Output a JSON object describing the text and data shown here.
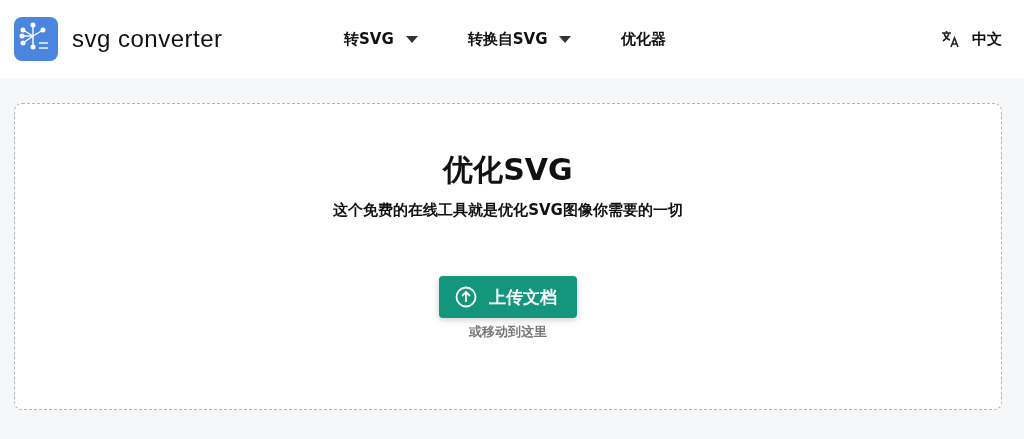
{
  "header": {
    "logo_text": "svg converter",
    "nav": [
      {
        "label": "转SVG",
        "kind": "dropdown"
      },
      {
        "label": "转换自SVG",
        "kind": "dropdown"
      },
      {
        "label": "优化器",
        "kind": "link"
      }
    ],
    "language": "中文"
  },
  "upload": {
    "title": "优化SVG",
    "subtitle": "这个免费的在线工具就是优化SVG图像你需要的一切",
    "button": "上传文档",
    "hint": "或移动到这里"
  }
}
